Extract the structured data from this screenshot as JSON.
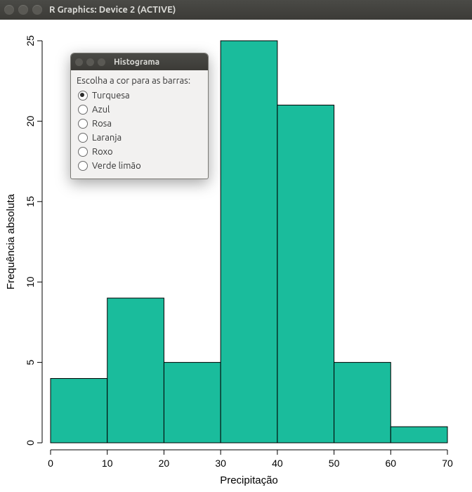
{
  "window": {
    "title": "R Graphics: Device 2 (ACTIVE)"
  },
  "dialog": {
    "title": "Histograma",
    "prompt": "Escolha a cor para as barras:",
    "options": [
      "Turquesa",
      "Azul",
      "Rosa",
      "Laranja",
      "Roxo",
      "Verde limão"
    ],
    "selected_index": 0
  },
  "chart_data": {
    "type": "bar",
    "xlabel": "Precipitação",
    "ylabel": "Frequência absoluta",
    "x_breaks": [
      0,
      10,
      20,
      30,
      40,
      50,
      60,
      70
    ],
    "y_ticks": [
      0,
      5,
      10,
      15,
      20,
      25
    ],
    "ylim": [
      0,
      25
    ],
    "xlim": [
      0,
      70
    ],
    "bar_color": "#1abc9c",
    "bins": [
      {
        "from": 0,
        "to": 10,
        "count": 4
      },
      {
        "from": 10,
        "to": 20,
        "count": 9
      },
      {
        "from": 20,
        "to": 30,
        "count": 5
      },
      {
        "from": 30,
        "to": 40,
        "count": 25
      },
      {
        "from": 40,
        "to": 50,
        "count": 21
      },
      {
        "from": 50,
        "to": 60,
        "count": 5
      },
      {
        "from": 60,
        "to": 70,
        "count": 1
      }
    ]
  }
}
